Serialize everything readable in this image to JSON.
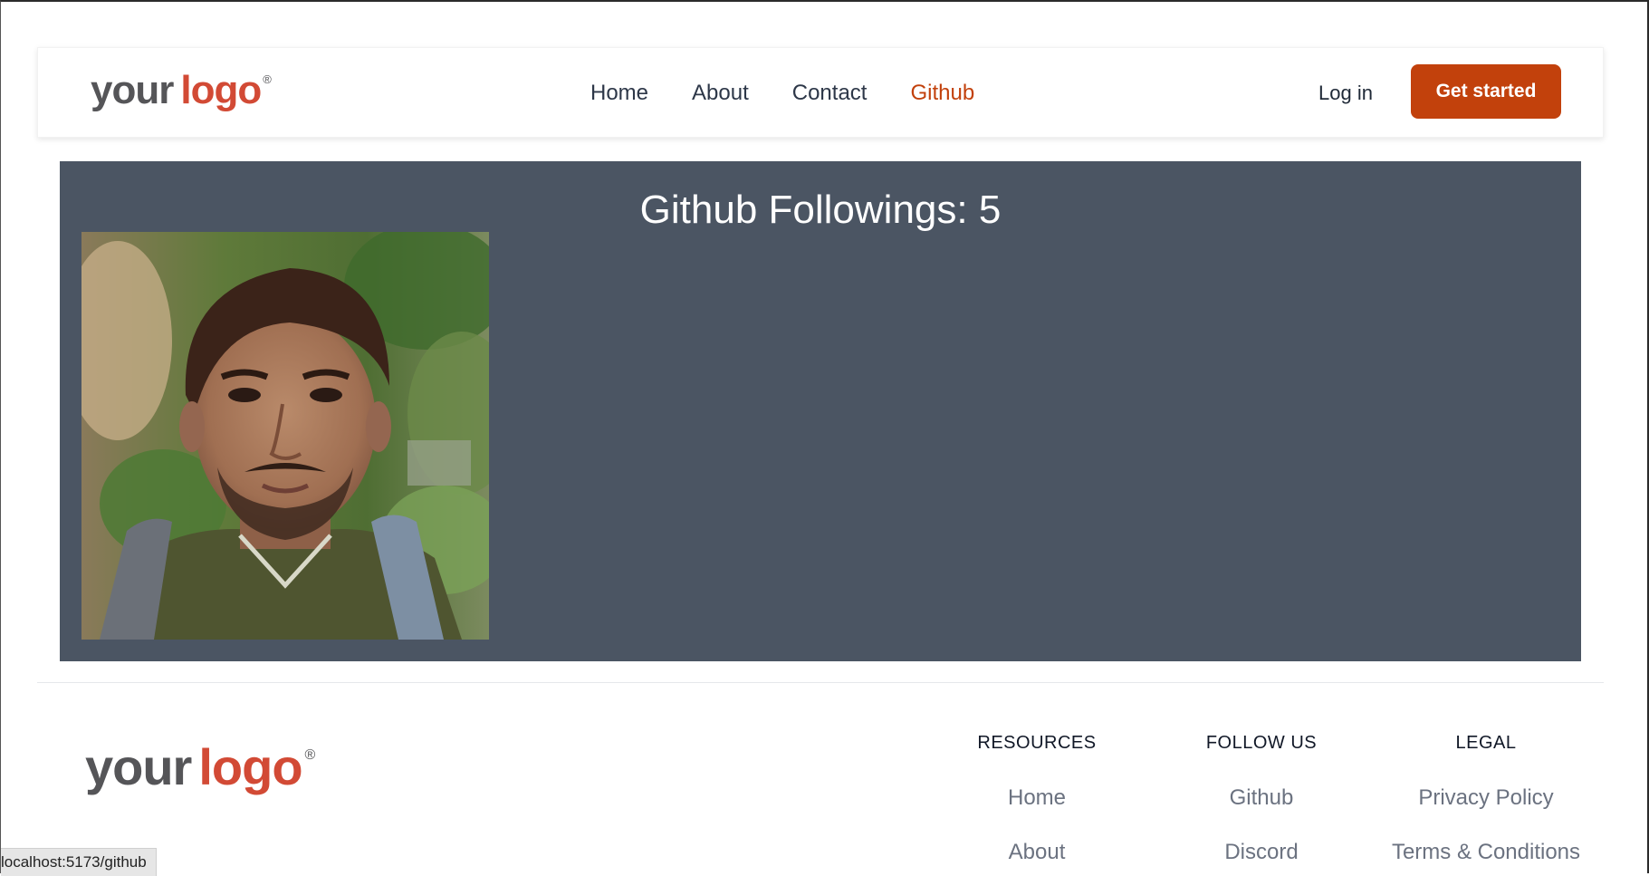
{
  "header": {
    "logo": {
      "part1": "your",
      "part2": "logo",
      "mark": "®"
    },
    "nav": [
      {
        "label": "Home",
        "active": false
      },
      {
        "label": "About",
        "active": false
      },
      {
        "label": "Contact",
        "active": false
      },
      {
        "label": "Github",
        "active": true
      }
    ],
    "login_label": "Log in",
    "cta_label": "Get started"
  },
  "main": {
    "title": "Github Followings: 5"
  },
  "footer": {
    "logo": {
      "part1": "your",
      "part2": "logo",
      "mark": "®"
    },
    "columns": [
      {
        "heading": "RESOURCES",
        "links": [
          "Home",
          "About"
        ]
      },
      {
        "heading": "FOLLOW US",
        "links": [
          "Github",
          "Discord"
        ]
      },
      {
        "heading": "LEGAL",
        "links": [
          "Privacy Policy",
          "Terms & Conditions"
        ]
      }
    ]
  },
  "status_bar": {
    "url": "localhost:5173/github"
  },
  "colors": {
    "accent": "#c2410c",
    "panel_bg": "#4b5563",
    "logo_red": "#d24a35",
    "logo_gray": "#555558"
  }
}
